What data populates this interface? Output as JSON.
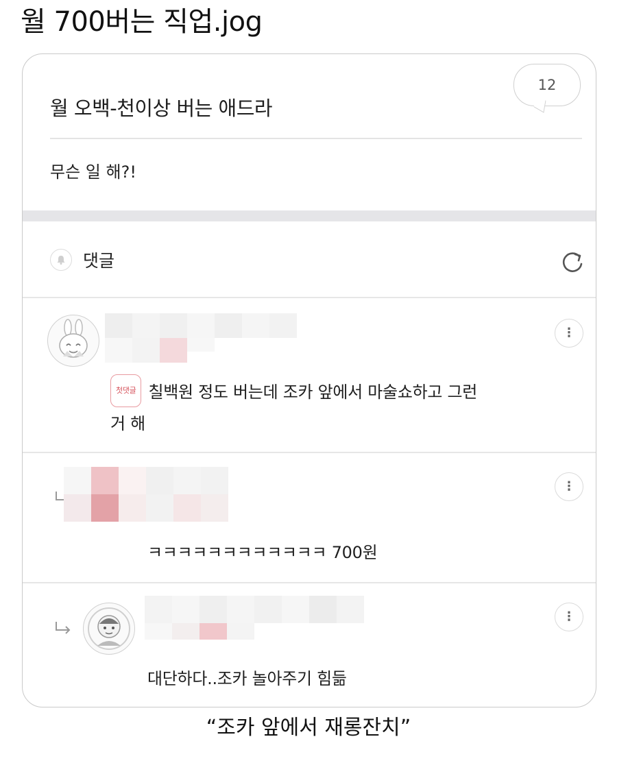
{
  "meme_title": "월 700버는 직업.jog",
  "post": {
    "title": "월 오백-천이상 버는 애드라",
    "comment_count": "12",
    "body": "무슨 일 해?!"
  },
  "comments_section": {
    "label": "댓글"
  },
  "comments": [
    {
      "badge": "첫댓글",
      "text_line1": "칠백원 정도 버는데 조카 앞에서 마술쇼하고 그런",
      "text_line2": "거 해"
    },
    {
      "text": "ㅋㅋㅋㅋㅋㅋㅋㅋㅋㅋㅋㅋ 700원"
    },
    {
      "text": "대단하다..조카 놀아주기 힘듦"
    }
  ],
  "caption": "“조카 앞에서 재롱잔치”",
  "colors": {
    "badge_red": "#d6525b",
    "divider": "#e6e6e6",
    "band": "#e5e5e8"
  },
  "icons": [
    "bell-icon",
    "refresh-icon",
    "more-icon",
    "reply-arrow-icon",
    "speech-bubble-icon"
  ]
}
